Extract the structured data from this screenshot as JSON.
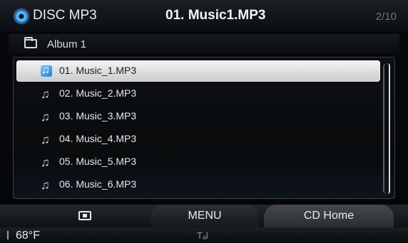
{
  "header": {
    "mode": "DISC MP3",
    "now_playing": "01. Music1.MP3",
    "track_counter": "2/10"
  },
  "album": {
    "label": "Album 1"
  },
  "tracks": [
    {
      "label": "01. Music_1.MP3",
      "selected": true
    },
    {
      "label": "02. Music_2.MP3",
      "selected": false
    },
    {
      "label": "03. Music_3.MP3",
      "selected": false
    },
    {
      "label": "04. Music_4.MP3",
      "selected": false
    },
    {
      "label": "05. Music_5.MP3",
      "selected": false
    },
    {
      "label": "06. Music_6.MP3",
      "selected": false
    }
  ],
  "bottom_bar": {
    "menu_label": "MENU",
    "cd_home_label": "CD Home"
  },
  "status": {
    "temperature": "68°F",
    "signal_icon": "Tₐl"
  },
  "icons": {
    "disc": "disc-icon",
    "folder": "folder-icon",
    "note": "music-note-icon"
  }
}
